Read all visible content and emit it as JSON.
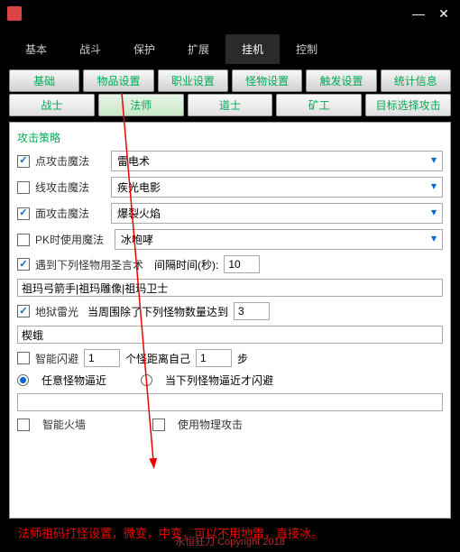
{
  "titlebar": {
    "min": "—",
    "close": "✕"
  },
  "main_tabs": [
    "基本",
    "战斗",
    "保护",
    "扩展",
    "挂机",
    "控制"
  ],
  "main_active": 4,
  "sub_tabs": [
    "基础",
    "物品设置",
    "职业设置",
    "怪物设置",
    "触发设置",
    "统计信息"
  ],
  "class_tabs": [
    "战士",
    "法师",
    "道士",
    "矿工",
    "目标选择攻击"
  ],
  "class_active": 1,
  "section_title": "攻击策略",
  "rows": {
    "point": {
      "label": "点攻击魔法",
      "checked": true,
      "value": "雷电术"
    },
    "line": {
      "label": "线攻击魔法",
      "checked": false,
      "value": "疾光电影"
    },
    "area": {
      "label": "面攻击魔法",
      "checked": true,
      "value": "爆裂火焰"
    },
    "pk": {
      "label": "PK时使用魔法",
      "checked": false,
      "value": "冰咆哮"
    },
    "shengyanshu": {
      "label": "遇到下列怪物用圣言术",
      "checked": true,
      "interval_label": "间隔时间(秒):",
      "interval": "10"
    },
    "monster_list1": "祖玛弓箭手|祖玛雕像|祖玛卫士",
    "diyu": {
      "label": "地狱雷光",
      "checked": true,
      "cond_label": "当周围除了下列怪物数量达到",
      "count": "3"
    },
    "monster_list2": "楔蛾",
    "dodge": {
      "label": "智能闪避",
      "checked": false,
      "num": "1",
      "mid": "个怪距离自己",
      "dist": "1",
      "suffix": "步"
    },
    "radio": {
      "any": "任意怪物逼近",
      "any_checked": true,
      "listed": "当下列怪物逼近才闪避",
      "listed_checked": false
    },
    "monster_list3": "",
    "fire": {
      "label": "智能火墙",
      "checked": false,
      "phys_label": "使用物理攻击",
      "phys_checked": false
    }
  },
  "note": "法师祖码打怪设置，微变，中变，可以不用地雷，直接冰。",
  "footer": "永恒狂刀    Copyright 2018"
}
